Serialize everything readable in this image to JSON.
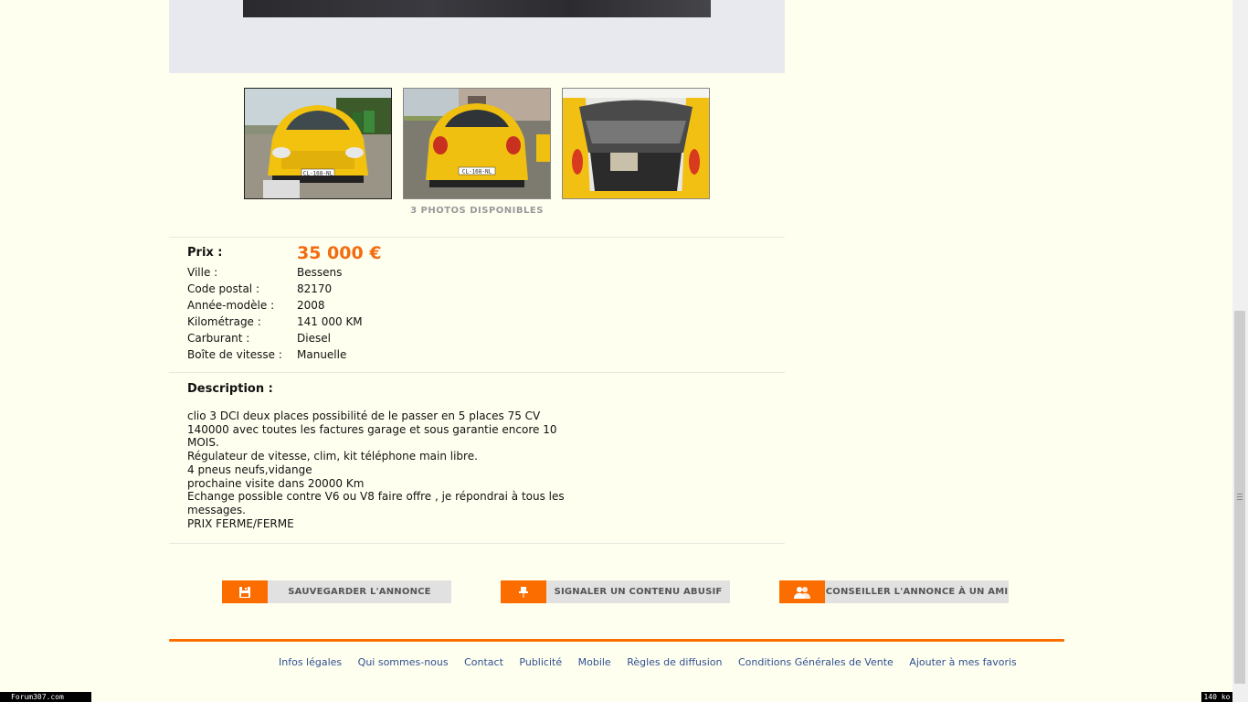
{
  "gallery": {
    "photos_count_label": "3 PHOTOS DISPONIBLES",
    "thumbnails": [
      {
        "name": "front",
        "selected": true,
        "plate": "CL-168-NL"
      },
      {
        "name": "rear",
        "selected": false,
        "plate": "CL-168-NL"
      },
      {
        "name": "trunk",
        "selected": false
      }
    ]
  },
  "specs": {
    "price_label": "Prix :",
    "price_value": "35 000 €",
    "rows": [
      {
        "label": "Ville :",
        "value": "Bessens"
      },
      {
        "label": "Code postal :",
        "value": "82170"
      },
      {
        "label": "Année-modèle :",
        "value": "2008"
      },
      {
        "label": "Kilométrage :",
        "value": "141 000 KM"
      },
      {
        "label": "Carburant :",
        "value": "Diesel"
      },
      {
        "label": "Boîte de vitesse :",
        "value": "Manuelle"
      }
    ]
  },
  "description": {
    "title": "Description :",
    "body": "clio 3 DCI deux places possibilité de le passer en 5 places 75 CV\n140000 avec toutes les factures garage et sous garantie encore 10\nMOIS.\nRégulateur de vitesse, clim, kit téléphone main libre.\n4 pneus neufs,vidange\nprochaine visite dans 20000 Km\nEchange possible contre V6 ou V8 faire offre , je répondrai à tous les\nmessages.\nPRIX FERME/FERME"
  },
  "actions": {
    "save": "SAUVEGARDER L'ANNONCE",
    "report": "SIGNALER UN CONTENU ABUSIF",
    "share": "CONSEILLER L'ANNONCE À UN AMI"
  },
  "footer": {
    "links": [
      "Infos légales",
      "Qui sommes-nous",
      "Contact",
      "Publicité",
      "Mobile",
      "Règles de diffusion",
      "Conditions Générales de Vente",
      "Ajouter à mes favoris"
    ]
  },
  "watermark": {
    "left": "Forum307.com",
    "right": "140 ko"
  },
  "colors": {
    "accent": "#fc6d00",
    "price": "#f26c10",
    "background": "#fffff0",
    "link": "#2f4f8f"
  }
}
